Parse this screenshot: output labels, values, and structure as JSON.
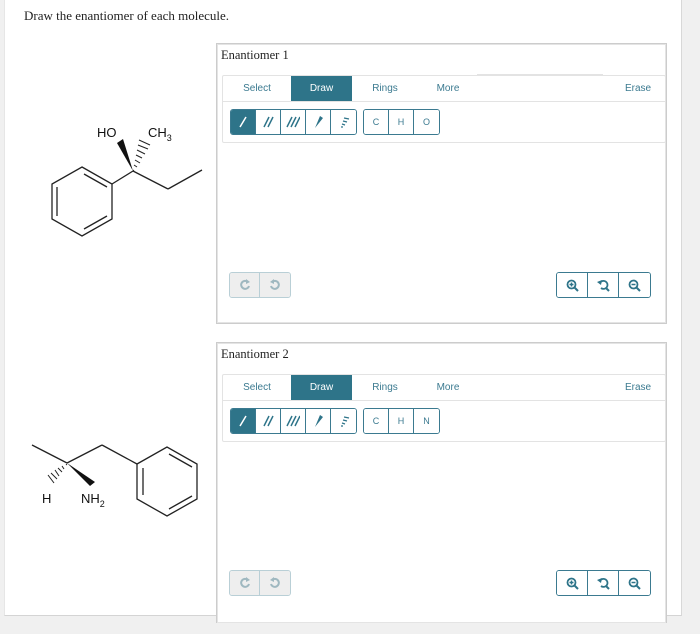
{
  "prompt": "Draw the enantiomer of each molecule.",
  "molecules": [
    {
      "name": "2-phenylbutan-2-ol",
      "labels": {
        "oh": "HO",
        "ch3": "CH",
        "ch3_sub": "3"
      }
    },
    {
      "name": "1-phenylpropan-2-amine",
      "labels": {
        "h": "H",
        "nh2": "NH",
        "nh2_sub": "2"
      }
    }
  ],
  "widgets": [
    {
      "title": "Enantiomer 1",
      "tabs": {
        "select": "Select",
        "draw": "Draw",
        "rings": "Rings",
        "more": "More",
        "erase": "Erase"
      },
      "active_tab": "Draw",
      "bond_tools": [
        "single-bond",
        "double-bond",
        "triple-bond",
        "wedge-bond",
        "hash-bond"
      ],
      "atoms": [
        "C",
        "H",
        "O"
      ],
      "undo_icons": [
        "undo-icon",
        "redo-icon"
      ],
      "zoom_icons": [
        "zoom-in-icon",
        "reset-zoom-icon",
        "zoom-out-icon"
      ]
    },
    {
      "title": "Enantiomer 2",
      "tabs": {
        "select": "Select",
        "draw": "Draw",
        "rings": "Rings",
        "more": "More",
        "erase": "Erase"
      },
      "active_tab": "Draw",
      "bond_tools": [
        "single-bond",
        "double-bond",
        "triple-bond",
        "wedge-bond",
        "hash-bond"
      ],
      "atoms": [
        "C",
        "H",
        "N"
      ],
      "undo_icons": [
        "undo-icon",
        "redo-icon"
      ],
      "zoom_icons": [
        "zoom-in-icon",
        "reset-zoom-icon",
        "zoom-out-icon"
      ]
    }
  ],
  "colors": {
    "accent": "#2e7489",
    "accent_text": "#3b7a90",
    "disabled_bg": "#eeeeee"
  }
}
